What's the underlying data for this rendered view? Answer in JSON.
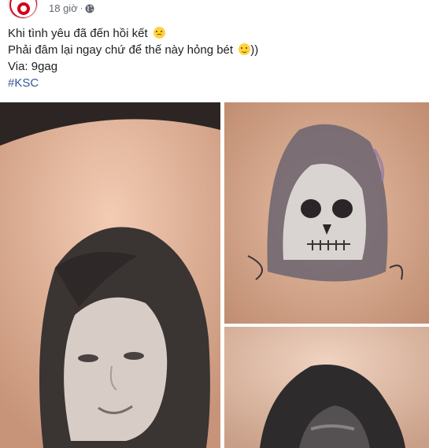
{
  "post": {
    "time": "18 giờ",
    "time_separator": "·",
    "privacy_icon": "globe-icon",
    "lines": [
      "Khi tình yêu đã đến hồi kết",
      "Phải đâm lại ngay chứ để thế này hỏng bét"
    ],
    "line2_suffix": "))",
    "via": "Via: 9gag",
    "hashtag": "#KSC"
  },
  "photos": [
    {
      "icon": "tattoo-woman-portrait-photo"
    },
    {
      "icon": "tattoo-grim-reaper-skull-photo"
    },
    {
      "icon": "tattoo-hooded-figure-photo"
    }
  ],
  "colors": {
    "link": "#385898",
    "meta": "#606770",
    "text": "#1c1e21"
  }
}
